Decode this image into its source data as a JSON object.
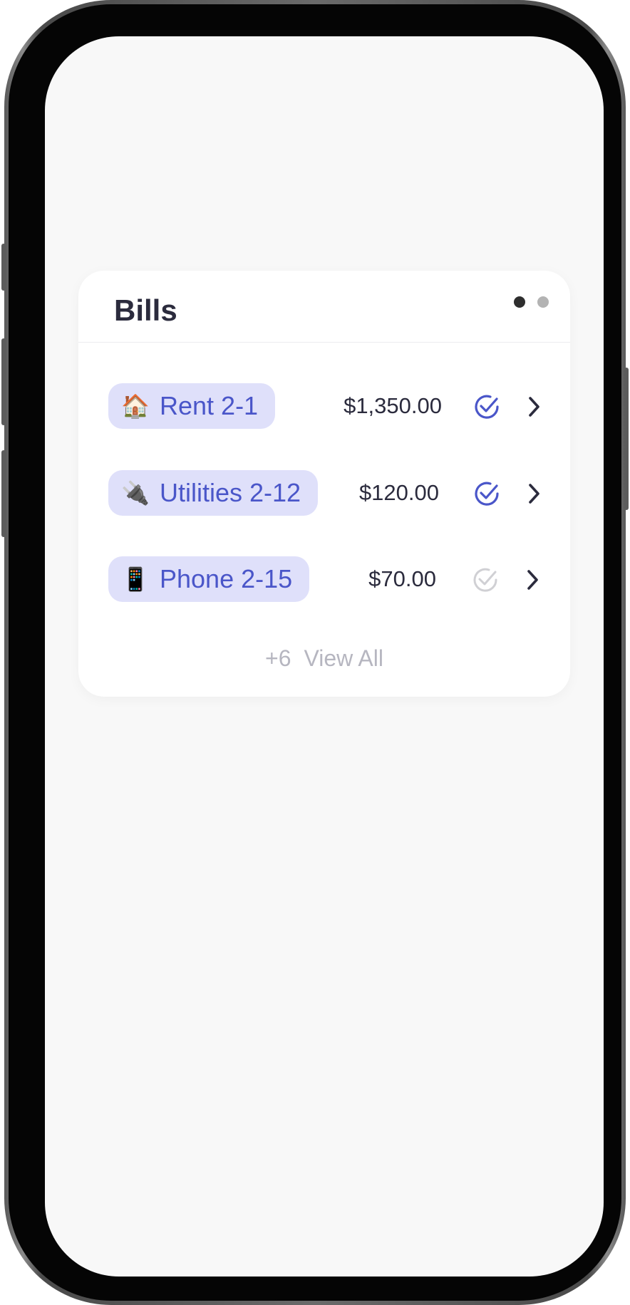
{
  "card": {
    "title": "Bills",
    "page_indicator": {
      "pages": 2,
      "active": 1
    }
  },
  "bills": [
    {
      "emoji": "🏠",
      "emoji_icon": "house-icon",
      "label": "Rent 2-1",
      "amount": "$1,350.00",
      "paid": true
    },
    {
      "emoji": "🔌",
      "emoji_icon": "plug-icon",
      "label": "Utilities 2-12",
      "amount": "$120.00",
      "paid": true
    },
    {
      "emoji": "📱",
      "emoji_icon": "phone-icon",
      "label": "Phone 2-15",
      "amount": "$70.00",
      "paid": false
    }
  ],
  "view_all": {
    "count": "+6",
    "label": "View All"
  },
  "colors": {
    "accent": "#4a56c9",
    "chip_background": "#dfe0fa",
    "check_paid": "#4a56c9",
    "check_unpaid": "#d0d0d4",
    "text_primary": "#2b2b3d",
    "text_muted": "#b6b6c0",
    "screen_background": "#f8f8f8"
  }
}
